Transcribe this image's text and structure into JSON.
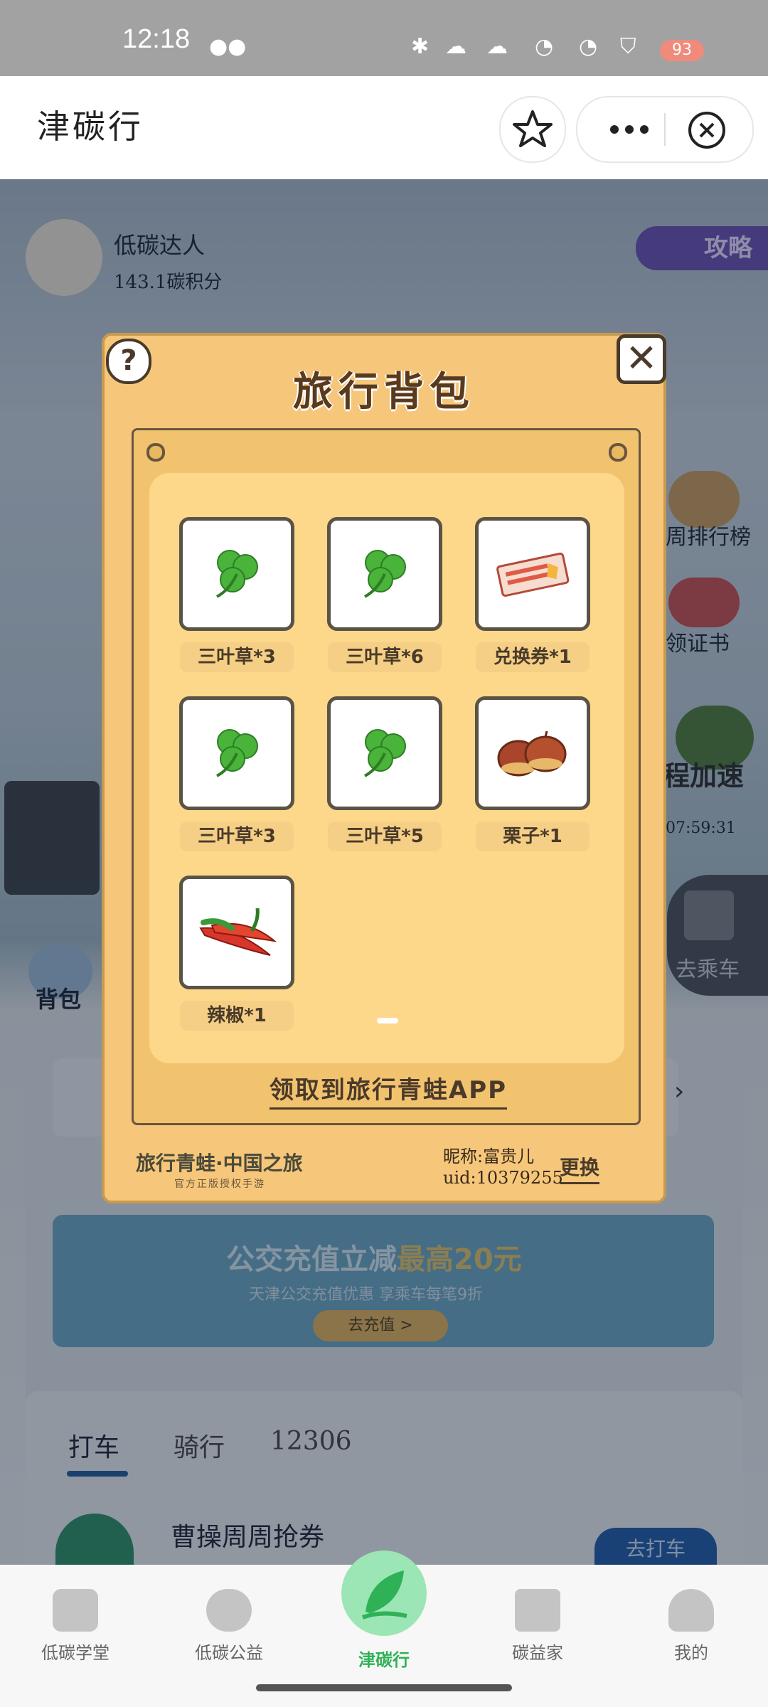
{
  "status_bar": {
    "time": "12:18",
    "battery": "93"
  },
  "title_bar": {
    "title": "津碳行"
  },
  "background": {
    "user_name": "低碳达人",
    "carbon_points": "143.1碳积分",
    "guide": "攻略",
    "weekly_rank": "周排行榜",
    "certificate": "领证书",
    "speed_up": "程加速",
    "speed_timer": "07:59:31",
    "backpack": "背包",
    "go_ride": "去乘车",
    "banner_title_a": "公交充值立减",
    "banner_title_b": "最高20元",
    "banner_sub": "天津公交充值优惠 享乘车每笔9折",
    "banner_btn": "去充值 >",
    "tabs": [
      "打车",
      "骑行",
      "12306"
    ],
    "list_item": "曹操周周抢券",
    "list_btn": "去打车"
  },
  "modal": {
    "title": "旅行背包",
    "help": "?",
    "close": "✕",
    "items": [
      {
        "label": "三叶草*3",
        "icon": "clover-icon"
      },
      {
        "label": "三叶草*6",
        "icon": "clover-icon"
      },
      {
        "label": "兑换券*1",
        "icon": "ticket-icon"
      },
      {
        "label": "三叶草*3",
        "icon": "clover-icon"
      },
      {
        "label": "三叶草*5",
        "icon": "clover-icon"
      },
      {
        "label": "栗子*1",
        "icon": "chestnut-icon"
      },
      {
        "label": "辣椒*1",
        "icon": "chili-icon"
      }
    ],
    "claim_link": "领取到旅行青蛙APP",
    "brand": "旅行青蛙·中国之旅",
    "brand_sub": "官方正版授权手游",
    "nickname": "昵称:富贵儿",
    "uid": "uid:10379255",
    "change": "更换"
  },
  "bottom_nav": [
    {
      "label": "低碳学堂"
    },
    {
      "label": "低碳公益"
    },
    {
      "label": "津碳行"
    },
    {
      "label": "碳益家"
    },
    {
      "label": "我的"
    }
  ],
  "colors": {
    "modal_bg": "#f6c77a",
    "nav_active": "#2fb257"
  }
}
